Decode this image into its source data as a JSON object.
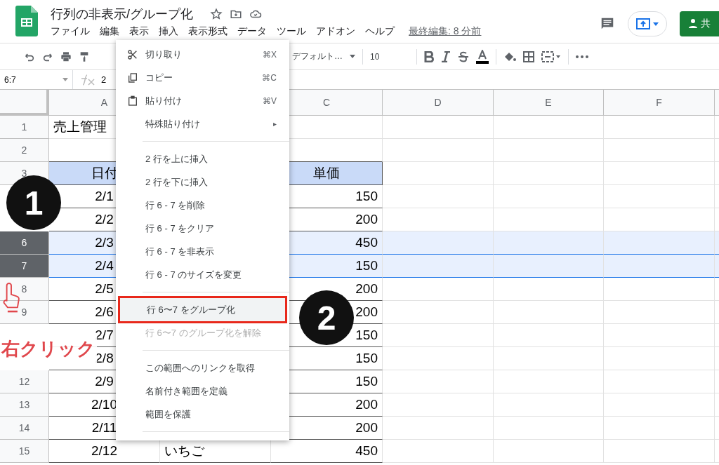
{
  "document": {
    "title": "行列の非表示/グループ化",
    "last_edit": "最終編集: 8 分前"
  },
  "menu_bar": [
    "ファイル",
    "編集",
    "表示",
    "挿入",
    "表示形式",
    "データ",
    "ツール",
    "アドオン",
    "ヘルプ"
  ],
  "share_button": {
    "label": "共"
  },
  "toolbar": {
    "font": "デフォルト…",
    "font_size": "10"
  },
  "formula_bar": {
    "name_box": "6:7",
    "value": "2"
  },
  "columns": [
    {
      "label": "A"
    },
    {},
    {
      "label": "C"
    },
    {
      "label": "D"
    },
    {
      "label": "E"
    },
    {
      "label": "F"
    }
  ],
  "rows": [
    {
      "number": "1",
      "selected": false,
      "kind": "title",
      "cells": [
        "売上管理",
        null,
        null
      ]
    },
    {
      "number": "2",
      "selected": false,
      "kind": "data",
      "cells": [
        null,
        null,
        null
      ]
    },
    {
      "number": "3",
      "selected": false,
      "kind": "header",
      "cells": [
        "日付",
        null,
        "単価"
      ]
    },
    {
      "selected": false,
      "kind": "data",
      "cells": [
        "2/1",
        null,
        "150"
      ]
    },
    {
      "selected": false,
      "kind": "data",
      "cells": [
        "2/2",
        null,
        "200"
      ]
    },
    {
      "number": "6",
      "selected": true,
      "kind": "data",
      "cells": [
        "2/3",
        null,
        "450"
      ]
    },
    {
      "number": "7",
      "selected": true,
      "kind": "data",
      "cells": [
        "2/4",
        null,
        "150"
      ]
    },
    {
      "number": "8",
      "selected": false,
      "kind": "data",
      "cells": [
        "2/5",
        null,
        "200"
      ]
    },
    {
      "number": "9",
      "selected": false,
      "kind": "data",
      "cells": [
        "2/6",
        null,
        "200"
      ]
    },
    {
      "selected": false,
      "kind": "data",
      "cells": [
        "2/7",
        null,
        "150"
      ]
    },
    {
      "selected": false,
      "kind": "data",
      "cells": [
        "2/8",
        null,
        "150"
      ]
    },
    {
      "number": "12",
      "selected": false,
      "kind": "data",
      "cells": [
        "2/9",
        null,
        "150"
      ]
    },
    {
      "number": "13",
      "selected": false,
      "kind": "data",
      "cells": [
        "2/10",
        null,
        "200"
      ]
    },
    {
      "number": "14",
      "selected": false,
      "kind": "data",
      "cells": [
        "2/11",
        null,
        "200"
      ]
    },
    {
      "number": "15",
      "selected": false,
      "kind": "data",
      "cells": [
        "2/12",
        "いちご",
        "450"
      ]
    }
  ],
  "context_menu": {
    "sections": [
      [
        {
          "kind": "cut",
          "label": "切り取り",
          "shortcut": "⌘X",
          "disabled": false,
          "selected": false
        },
        {
          "kind": "copy",
          "label": "コピー",
          "shortcut": "⌘C",
          "disabled": false,
          "selected": false
        },
        {
          "kind": "paste",
          "label": "貼り付け",
          "shortcut": "⌘V",
          "disabled": false,
          "selected": false
        },
        {
          "kind": "submenu",
          "label": "特殊貼り付け",
          "arrow": "▸",
          "disabled": false,
          "selected": false
        }
      ],
      [
        {
          "kind": "plain",
          "label": "2 行を上に挿入",
          "disabled": false,
          "selected": false
        },
        {
          "kind": "plain",
          "label": "2 行を下に挿入",
          "disabled": false,
          "selected": false
        },
        {
          "kind": "plain",
          "label": "行 6 - 7 を削除",
          "disabled": false,
          "selected": false
        },
        {
          "kind": "plain",
          "label": "行 6 - 7 をクリア",
          "disabled": false,
          "selected": false
        },
        {
          "kind": "plain",
          "label": "行 6 - 7 を非表示",
          "disabled": false,
          "selected": false
        },
        {
          "kind": "plain",
          "label": "行 6 - 7 のサイズを変更",
          "disabled": false,
          "selected": false
        }
      ],
      [
        {
          "kind": "plain",
          "label": "行 6〜7 をグループ化",
          "disabled": false,
          "selected": true
        },
        {
          "kind": "plain",
          "label": "行 6〜7 のグループ化を解除",
          "disabled": true,
          "selected": false
        }
      ],
      [
        {
          "kind": "plain",
          "label": "この範囲へのリンクを取得",
          "disabled": false,
          "selected": false
        },
        {
          "kind": "plain",
          "label": "名前付き範囲を定義",
          "disabled": false,
          "selected": false
        },
        {
          "kind": "plain",
          "label": "範囲を保護",
          "disabled": false,
          "selected": false
        }
      ]
    ]
  },
  "annotations": {
    "steps": [
      "1",
      "2"
    ],
    "hint": "右クリック"
  }
}
